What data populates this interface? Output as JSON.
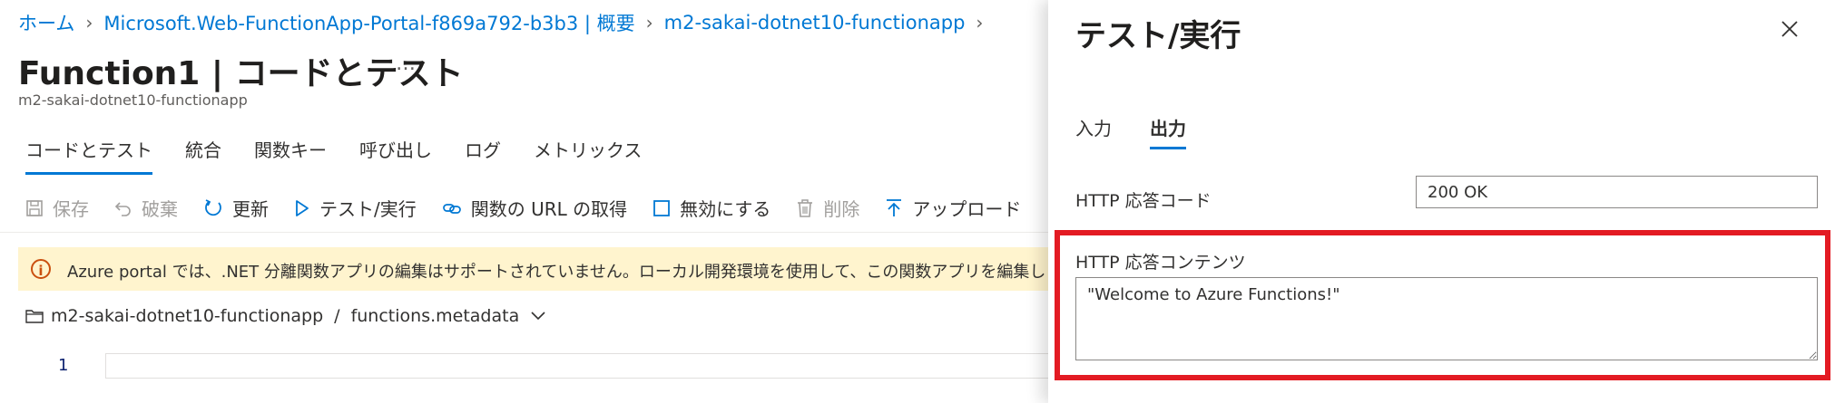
{
  "breadcrumb": {
    "items": [
      "ホーム",
      "Microsoft.Web-FunctionApp-Portal-f869a792-b3b3 | 概要",
      "m2-sakai-dotnet10-functionapp"
    ]
  },
  "page": {
    "title": "Function1 | コードとテスト",
    "more": "…",
    "subtitle": "m2-sakai-dotnet10-functionapp"
  },
  "tabs": [
    "コードとテスト",
    "統合",
    "関数キー",
    "呼び出し",
    "ログ",
    "メトリックス"
  ],
  "toolbar": {
    "save": "保存",
    "discard": "破棄",
    "refresh": "更新",
    "test_run": "テスト/実行",
    "get_url": "関数の URL の取得",
    "disable": "無効にする",
    "delete": "削除",
    "upload": "アップロード"
  },
  "banner": {
    "text": "Azure portal では、.NET 分離関数アプリの編集はサポートされていません。ローカル開発環境を使用して、この関数アプリを編集しま"
  },
  "file_path": {
    "folder": "m2-sakai-dotnet10-functionapp",
    "separator": "/",
    "file": "functions.metadata"
  },
  "editor": {
    "line_number": "1"
  },
  "panel": {
    "title": "テスト/実行",
    "tabs": [
      "入力",
      "出力"
    ],
    "status_label": "HTTP 応答コード",
    "status_value": "200 OK",
    "content_label": "HTTP 応答コンテンツ",
    "content_value": "\"Welcome to Azure Functions!\""
  },
  "colors": {
    "accent": "#0078d4",
    "highlight": "#e31b23",
    "warning_bg": "#fff4ce"
  }
}
